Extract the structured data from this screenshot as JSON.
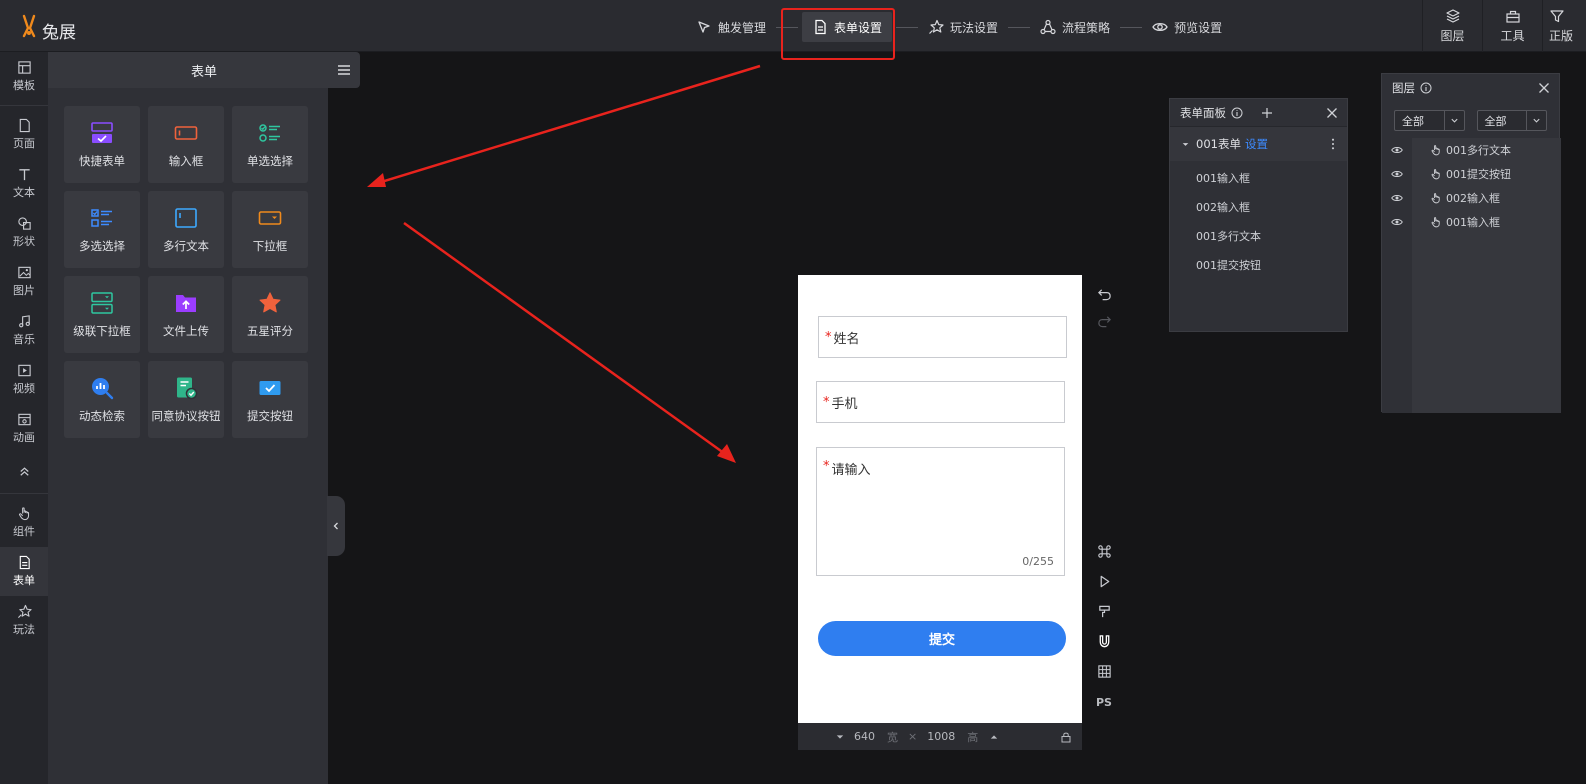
{
  "app": {
    "logo_text": "兔展"
  },
  "steps": [
    {
      "label": "触发管理"
    },
    {
      "label": "表单设置"
    },
    {
      "label": "玩法设置"
    },
    {
      "label": "流程策略"
    },
    {
      "label": "预览设置"
    }
  ],
  "top_tools": [
    {
      "label": "图层"
    },
    {
      "label": "工具"
    },
    {
      "label": "正版"
    }
  ],
  "rail": [
    {
      "label": "模板"
    },
    {
      "label": "页面"
    },
    {
      "label": "文本"
    },
    {
      "label": "形状"
    },
    {
      "label": "图片"
    },
    {
      "label": "音乐"
    },
    {
      "label": "视频"
    },
    {
      "label": "动画"
    },
    {
      "label": "组件"
    },
    {
      "label": "表单"
    },
    {
      "label": "玩法"
    }
  ],
  "panel": {
    "title": "表单",
    "items": [
      {
        "label": "快捷表单"
      },
      {
        "label": "输入框"
      },
      {
        "label": "单选选择"
      },
      {
        "label": "多选选择"
      },
      {
        "label": "多行文本"
      },
      {
        "label": "下拉框"
      },
      {
        "label": "级联下拉框"
      },
      {
        "label": "文件上传"
      },
      {
        "label": "五星评分"
      },
      {
        "label": "动态检索"
      },
      {
        "label": "同意协议按钮"
      },
      {
        "label": "提交按钮"
      }
    ]
  },
  "phone": {
    "required_mark": "*",
    "name_placeholder": "姓名",
    "phone_placeholder": "手机",
    "text_placeholder": "请输入",
    "counter": "0/255",
    "submit_label": "提交"
  },
  "sizebar": {
    "width": "640",
    "width_unit": "宽",
    "times": "×",
    "height": "1008",
    "height_unit": "高"
  },
  "side_tools": {
    "ps_label": "PS"
  },
  "form_panel": {
    "title": "表单面板",
    "root_label": "001表单",
    "root_link": "设置",
    "items": [
      "001输入框",
      "002输入框",
      "001多行文本",
      "001提交按钮"
    ]
  },
  "layer_panel": {
    "title": "图层",
    "filter_1": "全部",
    "filter_2": "全部",
    "layers": [
      "001多行文本",
      "001提交按钮",
      "002输入框",
      "001输入框"
    ]
  },
  "colors": {
    "accent_blue": "#2f7ef0",
    "highlight_red": "#e8231d",
    "logo_orange": "#f08a1c"
  }
}
